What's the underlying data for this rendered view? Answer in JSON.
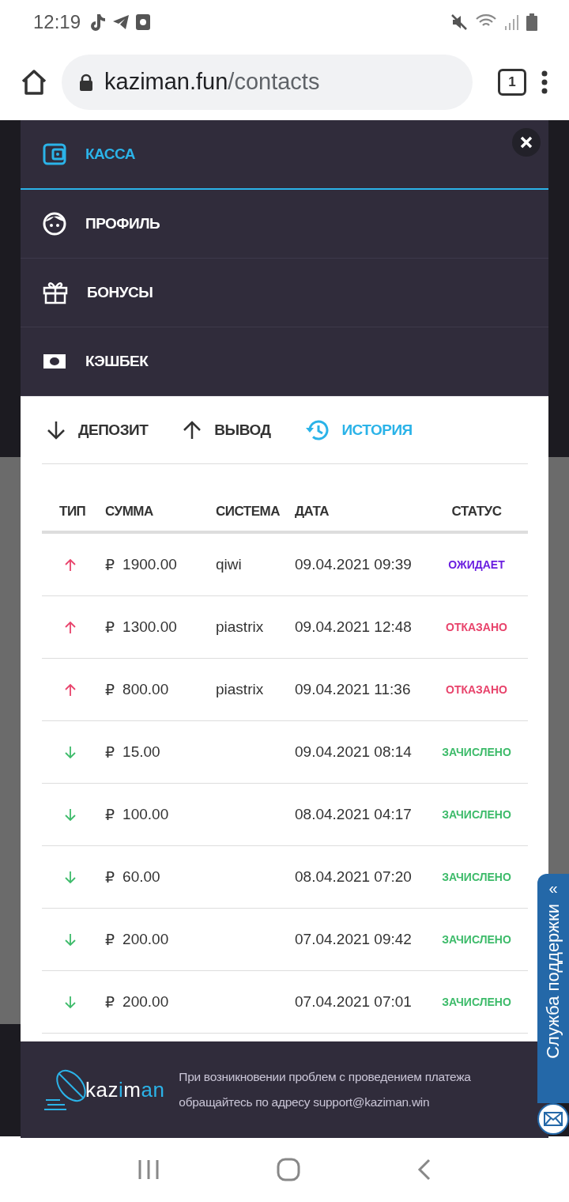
{
  "status_bar": {
    "time": "12:19"
  },
  "browser": {
    "url_host": "kaziman.fun",
    "url_path": "/contacts",
    "tab_count": "1"
  },
  "menu": {
    "items": [
      {
        "label": "КАССА",
        "selected": true
      },
      {
        "label": "ПРОФИЛЬ",
        "selected": false
      },
      {
        "label": "БОНУСЫ",
        "selected": false
      },
      {
        "label": "КЭШБЕК",
        "selected": false
      }
    ]
  },
  "tabs": [
    {
      "label": "ДЕПОЗИТ",
      "selected": false
    },
    {
      "label": "ВЫВОД",
      "selected": false
    },
    {
      "label": "ИСТОРИЯ",
      "selected": true
    }
  ],
  "table": {
    "columns": [
      "ТИП",
      "СУММА",
      "СИСТЕМА",
      "ДАТА",
      "СТАТУС"
    ],
    "rows": [
      {
        "kind": "withdrawal",
        "currency": "₽",
        "amount": "1900.00",
        "system": "qiwi",
        "date": "09.04.2021 09:39",
        "status": "ОЖИДАЕТ",
        "color": "#6a1ee0"
      },
      {
        "kind": "withdrawal",
        "currency": "₽",
        "amount": "1300.00",
        "system": "piastrix",
        "date": "09.04.2021 12:48",
        "status": "ОТКАЗАНО",
        "color": "#e8436b"
      },
      {
        "kind": "withdrawal",
        "currency": "₽",
        "amount": "800.00",
        "system": "piastrix",
        "date": "09.04.2021 11:36",
        "status": "ОТКАЗАНО",
        "color": "#e8436b"
      },
      {
        "kind": "deposit",
        "currency": "₽",
        "amount": "15.00",
        "date": "09.04.2021 08:14",
        "status": "ЗАЧИСЛЕНО",
        "color": "#3dbb6a"
      },
      {
        "kind": "deposit",
        "currency": "₽",
        "amount": "100.00",
        "date": "08.04.2021 04:17",
        "status": "ЗАЧИСЛЕНО",
        "color": "#3dbb6a"
      },
      {
        "kind": "deposit",
        "currency": "₽",
        "amount": "60.00",
        "date": "08.04.2021 07:20",
        "status": "ЗАЧИСЛЕНО",
        "color": "#3dbb6a"
      },
      {
        "kind": "deposit",
        "currency": "₽",
        "amount": "200.00",
        "date": "07.04.2021 09:42",
        "status": "ЗАЧИСЛЕНО",
        "color": "#3dbb6a"
      },
      {
        "kind": "deposit",
        "currency": "₽",
        "amount": "200.00",
        "date": "07.04.2021 07:01",
        "status": "ЗАЧИСЛЕНО",
        "color": "#3dbb6a"
      }
    ]
  },
  "footer": {
    "logo_text_1": "kaz",
    "logo_text_2": "i",
    "logo_text_3": "m",
    "logo_text_4": "an",
    "note": "При возникновении проблем с проведением платежа обращайтесь по адресу support@kaziman.win"
  },
  "support_tab": {
    "label": "Служба поддержки",
    "chevron": "«"
  }
}
